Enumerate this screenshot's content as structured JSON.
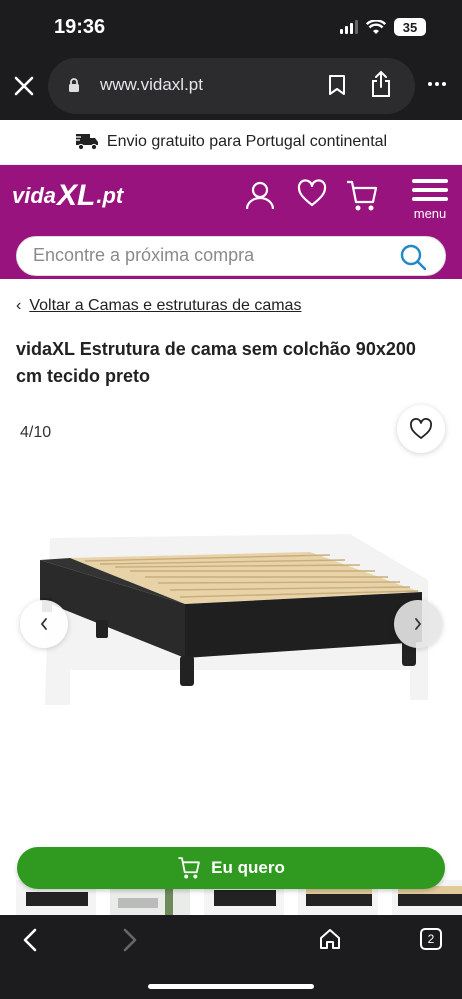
{
  "status_bar": {
    "time": "19:36",
    "battery": "35"
  },
  "browser": {
    "url": "www.vidaxl.pt",
    "tab_count": "2"
  },
  "banner": {
    "text": "Envio gratuito para Portugal continental"
  },
  "header": {
    "logo_pre": "vida",
    "logo_xl": "XL",
    "logo_post": ".pt",
    "menu_label": "menu",
    "search_placeholder": "Encontre a próxima compra"
  },
  "breadcrumb": {
    "chevron": "‹",
    "label": "Voltar a Camas e estruturas de camas"
  },
  "product": {
    "title": "vidaXL Estrutura de cama sem colchão 90x200 cm tecido preto",
    "image_counter": "4/10",
    "cta_label": "Eu quero"
  },
  "colors": {
    "brand_purple": "#99137f",
    "cta_green": "#2f9a1f",
    "chrome_dark": "#1c1c1e"
  },
  "icons": [
    "close-icon",
    "lock-icon",
    "bookmark-icon",
    "share-icon",
    "more-icon",
    "truck-icon",
    "user-icon",
    "heart-icon",
    "cart-icon",
    "menu-icon",
    "search-icon",
    "chevron-left-icon",
    "chevron-right-icon",
    "back-icon",
    "forward-icon",
    "home-icon",
    "tabs-icon"
  ]
}
